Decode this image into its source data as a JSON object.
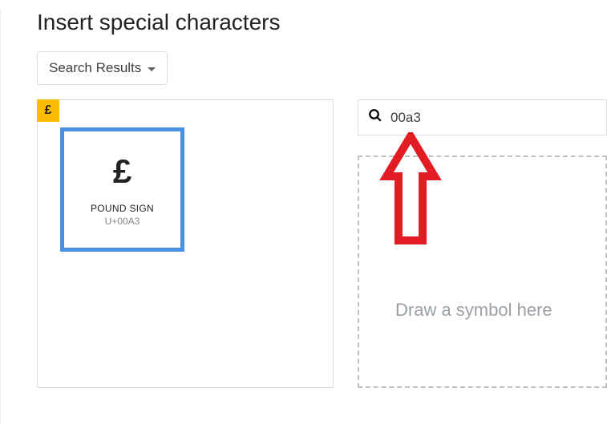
{
  "dialog": {
    "title": "Insert special characters"
  },
  "dropdown": {
    "label": "Search Results"
  },
  "char_tile": {
    "glyph": "£"
  },
  "preview": {
    "glyph": "£",
    "name": "POUND SIGN",
    "code": "U+00A3"
  },
  "search": {
    "value": "00a3"
  },
  "draw": {
    "placeholder": "Draw a symbol here"
  }
}
